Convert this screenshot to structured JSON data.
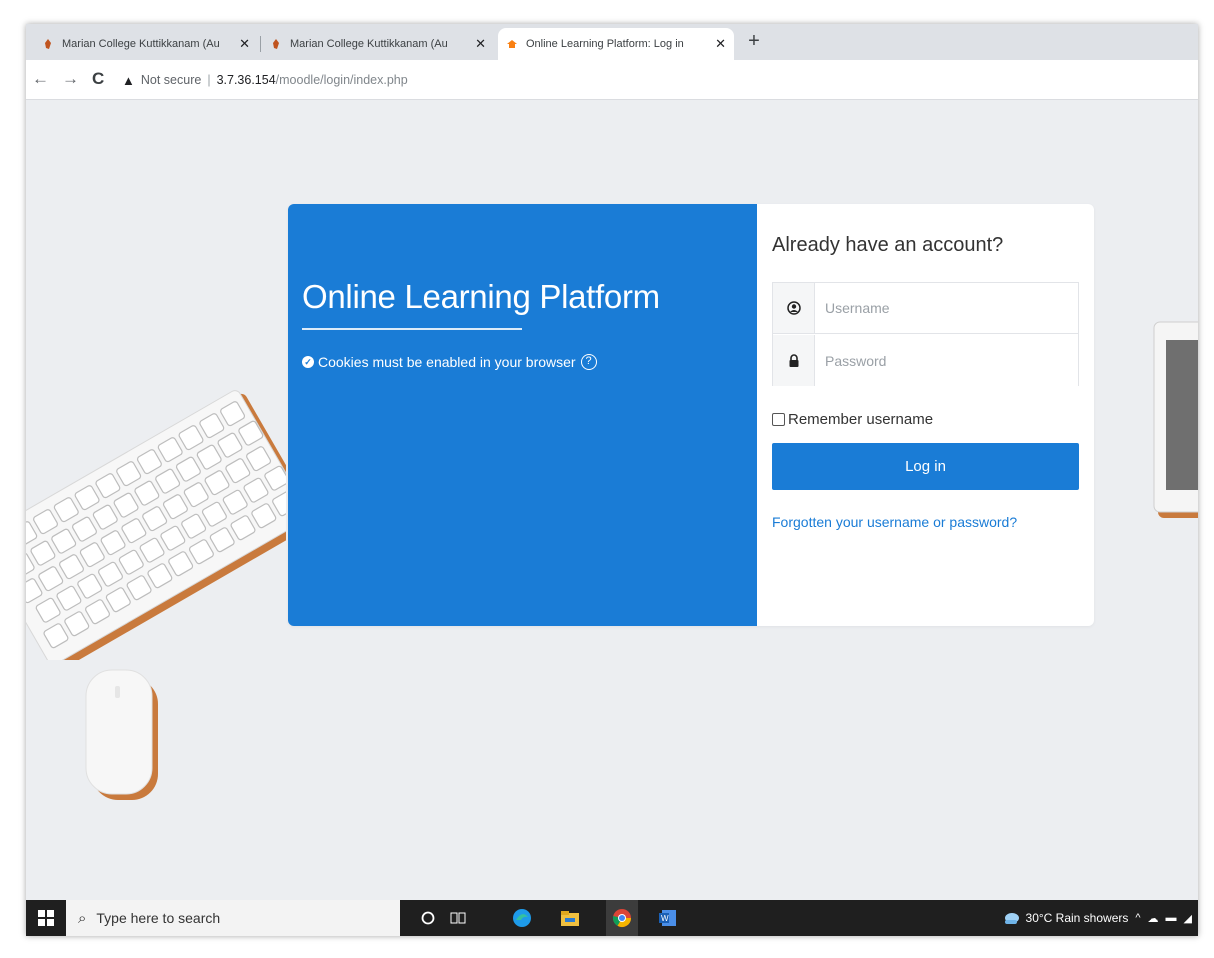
{
  "browser": {
    "tabs": [
      {
        "title": "Marian College Kuttikkanam (Au",
        "close": "✕",
        "active": false
      },
      {
        "title": "Marian College Kuttikkanam (Au",
        "close": "✕",
        "active": false
      },
      {
        "title": "Online Learning Platform: Log in",
        "close": "✕",
        "active": true
      }
    ],
    "new_tab": "+",
    "nav": {
      "back": "←",
      "forward": "→",
      "reload": "C"
    },
    "address": {
      "security_icon": "▲",
      "security_label": "Not secure",
      "separator": "|",
      "host": "3.7.36.154",
      "path": "/moodle/login/index.php"
    }
  },
  "login": {
    "site_name": "Online Learning Platform",
    "cookies_notice": "Cookies must be enabled in your browser",
    "heading": "Already have an account?",
    "username_placeholder": "Username",
    "password_placeholder": "Password",
    "remember_label": "Remember username",
    "login_button": "Log in",
    "forgot_link": "Forgotten your username or password?"
  },
  "taskbar": {
    "search_placeholder": "Type here to search",
    "weather": "30°C  Rain showers",
    "tray_chevron": "^"
  },
  "colors": {
    "brand_blue": "#1a7cd6",
    "page_bg": "#eceef1",
    "taskbar": "#1f1f1f"
  }
}
